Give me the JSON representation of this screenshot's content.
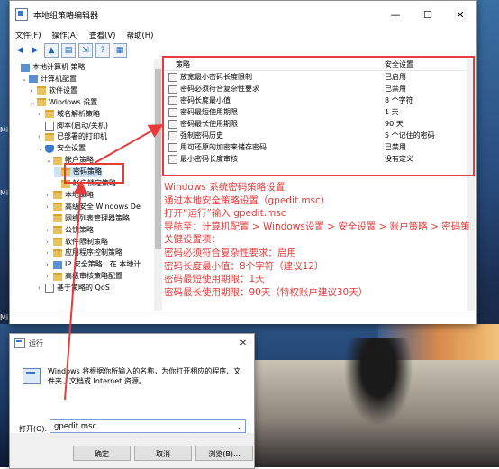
{
  "desktop": {
    "side_labels": [
      "Mi",
      "Mi",
      "Mi"
    ]
  },
  "window": {
    "title": "本地组策略编辑器",
    "minimize": "—",
    "maximize": "☐",
    "close": "✕",
    "menu": [
      "文件(F)",
      "操作(A)",
      "查看(V)",
      "帮助(H)"
    ]
  },
  "tree": {
    "items": [
      {
        "label": "本地计算机 策略",
        "indent": 0,
        "arrow": "",
        "icon": "pc"
      },
      {
        "label": "计算机配置",
        "indent": 1,
        "arrow": "v",
        "icon": "pc"
      },
      {
        "label": "软件设置",
        "indent": 2,
        "arrow": ">",
        "icon": "folder"
      },
      {
        "label": "Windows 设置",
        "indent": 2,
        "arrow": "v",
        "icon": "folder"
      },
      {
        "label": "域名解析策略",
        "indent": 3,
        "arrow": ">",
        "icon": "folder"
      },
      {
        "label": "脚本(启动/关机)",
        "indent": 3,
        "arrow": "",
        "icon": "doc"
      },
      {
        "label": "已部署的打印机",
        "indent": 3,
        "arrow": ">",
        "icon": "folder"
      },
      {
        "label": "安全设置",
        "indent": 3,
        "arrow": "v",
        "icon": "shield"
      },
      {
        "label": "帐户策略",
        "indent": 4,
        "arrow": "v",
        "icon": "folder"
      },
      {
        "label": "密码策略",
        "indent": 5,
        "arrow": "",
        "icon": "folder"
      },
      {
        "label": "帐户锁定策略",
        "indent": 5,
        "arrow": "",
        "icon": "folder"
      },
      {
        "label": "本地策略",
        "indent": 4,
        "arrow": ">",
        "icon": "folder"
      },
      {
        "label": "高级安全 Windows De",
        "indent": 4,
        "arrow": ">",
        "icon": "folder"
      },
      {
        "label": "网络列表管理器策略",
        "indent": 4,
        "arrow": "",
        "icon": "folder"
      },
      {
        "label": "公钥策略",
        "indent": 4,
        "arrow": ">",
        "icon": "folder"
      },
      {
        "label": "软件限制策略",
        "indent": 4,
        "arrow": ">",
        "icon": "folder"
      },
      {
        "label": "应用程序控制策略",
        "indent": 4,
        "arrow": ">",
        "icon": "folder"
      },
      {
        "label": "IP 安全策略，在 本地计",
        "indent": 4,
        "arrow": ">",
        "icon": "pc"
      },
      {
        "label": "高级审核策略配置",
        "indent": 4,
        "arrow": ">",
        "icon": "folder"
      },
      {
        "label": "基于策略的 QoS",
        "indent": 3,
        "arrow": ">",
        "icon": "doc"
      }
    ]
  },
  "list": {
    "col_policy": "策略",
    "col_setting": "安全设置",
    "rows": [
      {
        "policy": "放宽最小密码长度限制",
        "setting": "已启用"
      },
      {
        "policy": "密码必须符合复杂性要求",
        "setting": "已禁用"
      },
      {
        "policy": "密码长度最小值",
        "setting": "8 个字符"
      },
      {
        "policy": "密码最短使用期限",
        "setting": "1 天"
      },
      {
        "policy": "密码最长使用期限",
        "setting": "90 天"
      },
      {
        "policy": "强制密码历史",
        "setting": "5 个记住的密码"
      },
      {
        "policy": "用可还原的加密来储存密码",
        "setting": "已禁用"
      },
      {
        "policy": "最小密码长度审核",
        "setting": "没有定义"
      }
    ]
  },
  "notes": [
    "Windows 系统密码策略设置",
    "通过本地安全策略设置（gpedit.msc）",
    "打开“运行”输入 gpedit.msc",
    "导航至：计算机配置 > Windows设置 > 安全设置 > 账户策略 > 密码策",
    "关键设置项：",
    "密码必须符合复杂性要求：启用",
    "密码长度最小值：8个字符（建议12）",
    "密码最短使用期限：1天",
    "密码最长使用期限：90天（特权账户建议30天）"
  ],
  "run_dialog": {
    "title": "运行",
    "close": "✕",
    "description": "Windows 将根据你所输入的名称，为你打开相应的程序、文件夹、文档或 Internet 资源。",
    "open_label": "打开(O):",
    "input_value": "gpedit.msc",
    "ok": "确定",
    "cancel": "取消",
    "browse": "浏览(B)..."
  },
  "colors": {
    "annotation": "#e53b3b",
    "selection": "#cce8ff"
  }
}
